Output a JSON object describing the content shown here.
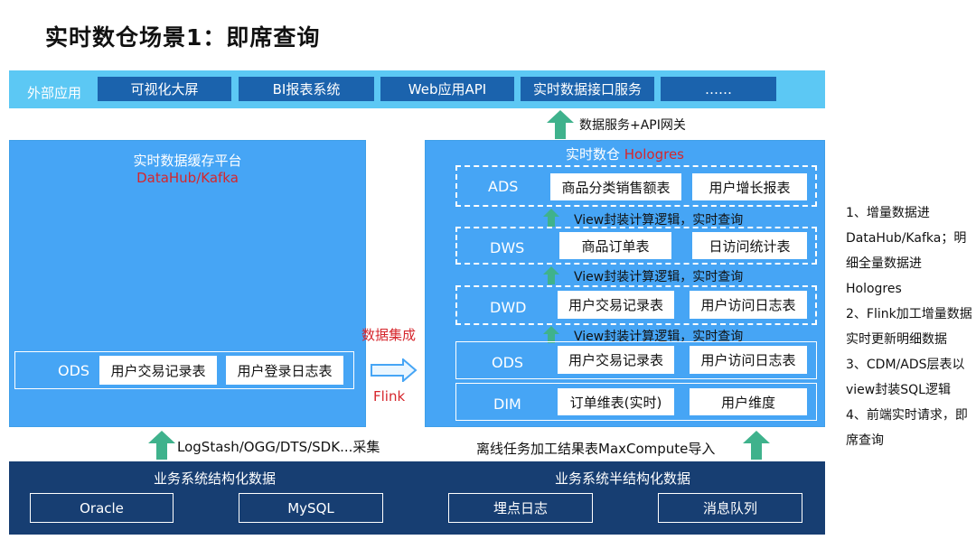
{
  "title": "实时数仓场景1：即席查询",
  "external": {
    "label": "外部应用",
    "apps": [
      "可视化大屏",
      "BI报表系统",
      "Web应用API",
      "实时数据接口服务",
      "……"
    ]
  },
  "api_gateway_label": "数据服务+API网关",
  "cache_platform": {
    "title": "实时数据缓存平台",
    "subtitle": "DataHub/Kafka",
    "ods_label": "ODS",
    "ods_tables": [
      "用户交易记录表",
      "用户登录日志表"
    ]
  },
  "integration": {
    "label": "数据集成",
    "engine": "Flink"
  },
  "warehouse": {
    "title": "实时数仓",
    "engine": "Hologres",
    "layers": [
      {
        "name": "ADS",
        "tables": [
          "商品分类销售额表",
          "用户增长报表"
        ]
      },
      {
        "name": "DWS",
        "tables": [
          "商品订单表",
          "日访问统计表"
        ]
      },
      {
        "name": "DWD",
        "tables": [
          "用户交易记录表",
          "用户访问日志表"
        ]
      },
      {
        "name": "ODS",
        "tables": [
          "用户交易记录表",
          "用户访问日志表"
        ]
      },
      {
        "name": "DIM",
        "tables": [
          "订单维表(实时)",
          "用户维度"
        ]
      }
    ],
    "view_labels": [
      "View封装计算逻辑，实时查询",
      "View封装计算逻辑，实时查询",
      "View封装计算逻辑，实时查询"
    ]
  },
  "collect_label": "LogStash/OGG/DTS/SDK...采集",
  "offline_label": "离线任务加工结果表MaxCompute导入",
  "sources": {
    "structured": {
      "title": "业务系统结构化数据",
      "items": [
        "Oracle",
        "MySQL"
      ]
    },
    "semi": {
      "title": "业务系统半结构化数据",
      "items": [
        "埋点日志",
        "消息队列"
      ]
    }
  },
  "notes": [
    "1、增量数据进DataHub/Kafka；明细全量数据进Hologres",
    "2、Flink加工增量数据实时更新明细数据",
    "3、CDM/ADS层表以view封装SQL逻辑",
    "4、前端实时请求，即席查询"
  ],
  "colors": {
    "panel": "#46a5f5",
    "ext_bar": "#5cc8f4",
    "dark_box": "#1b63ad",
    "bottom": "#173e72",
    "arrow": "#3fb28c",
    "accent_red": "#d6262c"
  }
}
